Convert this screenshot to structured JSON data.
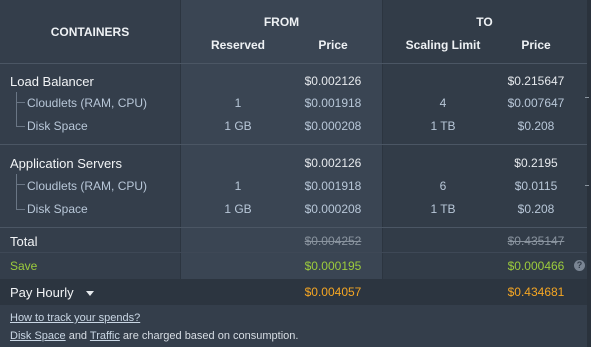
{
  "header": {
    "containers": "CONTAINERS",
    "from": "FROM",
    "to": "TO",
    "reserved": "Reserved",
    "price": "Price",
    "scaling_limit": "Scaling Limit",
    "price_to": "Price"
  },
  "groups": [
    {
      "name": "Load Balancer",
      "from_price": "$0.002126",
      "to_price": "$0.215647",
      "rows": [
        {
          "label": "Cloudlets (RAM, CPU)",
          "reserved": "1",
          "from_price": "$0.001918",
          "scaling_limit": "4",
          "to_price": "$0.007647"
        },
        {
          "label": "Disk Space",
          "reserved": "1 GB",
          "from_price": "$0.000208",
          "scaling_limit": "1 TB",
          "to_price": "$0.208"
        }
      ]
    },
    {
      "name": "Application Servers",
      "from_price": "$0.002126",
      "to_price": "$0.2195",
      "rows": [
        {
          "label": "Cloudlets (RAM, CPU)",
          "reserved": "1",
          "from_price": "$0.001918",
          "scaling_limit": "6",
          "to_price": "$0.0115"
        },
        {
          "label": "Disk Space",
          "reserved": "1 GB",
          "from_price": "$0.000208",
          "scaling_limit": "1 TB",
          "to_price": "$0.208"
        }
      ]
    }
  ],
  "total": {
    "label": "Total",
    "from": "$0.004252",
    "to": "$0.435147"
  },
  "save": {
    "label": "Save",
    "from": "$0.000195",
    "to": "$0.000466",
    "help": "?"
  },
  "pay": {
    "label": "Pay Hourly",
    "from": "$0.004057",
    "to": "$0.434681"
  },
  "footer": {
    "track_link": "How to track your spends?",
    "disk_link": "Disk Space",
    "and": " and ",
    "traffic_link": "Traffic",
    "suffix": " are charged based on consumption."
  },
  "colors": {
    "background": "#343e4b",
    "save_green": "#9ccc3c",
    "pay_orange": "#f5a623"
  }
}
